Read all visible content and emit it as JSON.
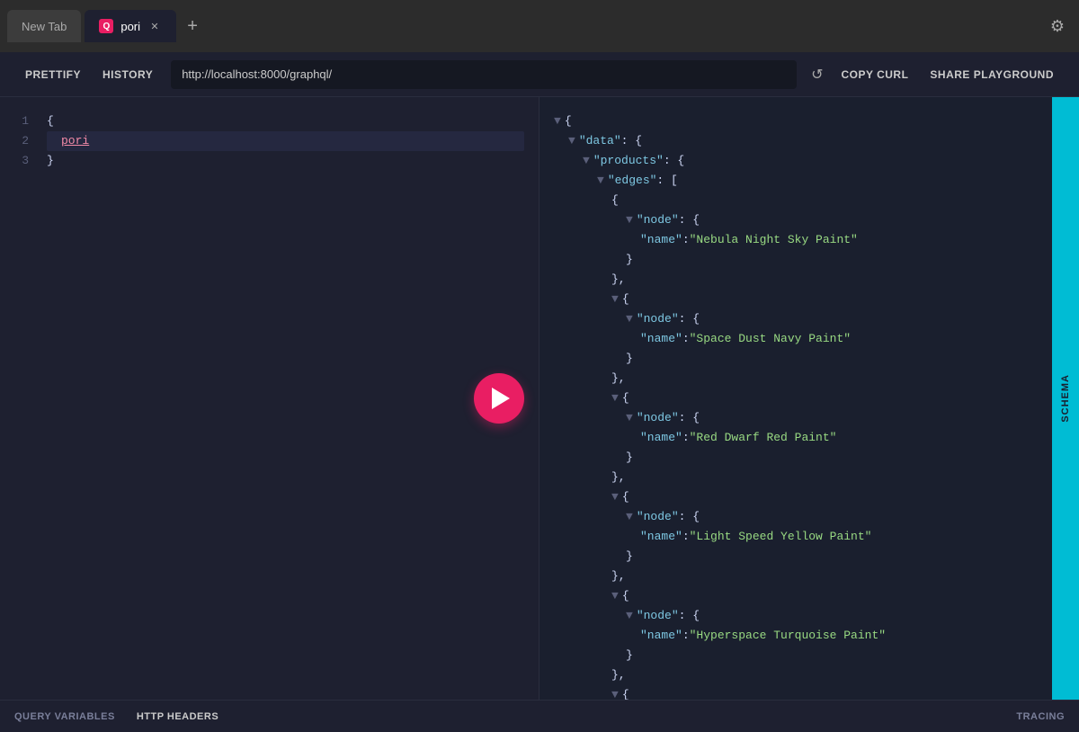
{
  "browser": {
    "inactive_tab_label": "New Tab",
    "active_tab_label": "pori",
    "active_tab_favicon": "Q",
    "new_tab_icon": "+",
    "settings_icon": "⚙"
  },
  "toolbar": {
    "prettify_label": "PRETTIFY",
    "history_label": "HISTORY",
    "url_value": "http://localhost:8000/graphql/",
    "refresh_icon": "↺",
    "copy_curl_label": "COPY CURL",
    "share_playground_label": "SHARE PLAYGROUND"
  },
  "editor": {
    "lines": [
      {
        "number": 1,
        "content": "{",
        "type": "brace"
      },
      {
        "number": 2,
        "content": "  pori",
        "type": "field"
      },
      {
        "number": 3,
        "content": "}",
        "type": "brace"
      }
    ]
  },
  "results": {
    "json": {
      "data": {
        "products": {
          "edges": [
            {
              "node": {
                "name": "Nebula Night Sky Paint"
              }
            },
            {
              "node": {
                "name": "Space Dust Navy Paint"
              }
            },
            {
              "node": {
                "name": "Red Dwarf Red Paint"
              }
            },
            {
              "node": {
                "name": "Light Speed Yellow Paint"
              }
            },
            {
              "node": {
                "name": "Hyperspace Turquoise Paint"
              }
            }
          ]
        }
      }
    }
  },
  "bottom_bar": {
    "query_variables_label": "QUERY VARIABLES",
    "http_headers_label": "HTTP HEADERS",
    "tracing_label": "TRACING"
  },
  "schema": {
    "label": "SCHEMA"
  }
}
